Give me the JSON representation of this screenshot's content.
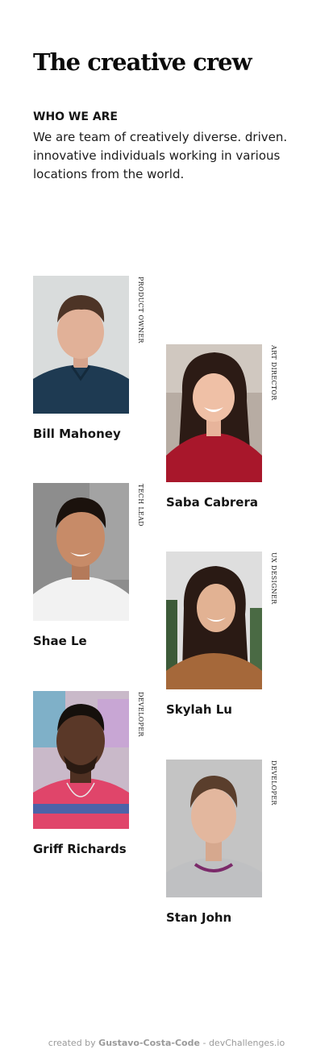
{
  "header": {
    "title": "The creative crew",
    "subtitle": "WHO WE ARE",
    "intro": "We are team of creatively diverse. driven. innovative individuals working in various locations from the world."
  },
  "team": [
    {
      "name": "Bill Mahoney",
      "role": "PRODUCT OWNER"
    },
    {
      "name": "Saba Cabrera",
      "role": "ART DIRECTOR"
    },
    {
      "name": "Shae Le",
      "role": "TECH LEAD"
    },
    {
      "name": "Skylah Lu",
      "role": "UX DESIGNER"
    },
    {
      "name": "Griff Richards",
      "role": "DEVELOPER"
    },
    {
      "name": "Stan John",
      "role": "DEVELOPER"
    }
  ],
  "footer": {
    "prefix": "created by",
    "author": "Gustavo-Costa-Code",
    "separator": "-",
    "site": "devChallenges.io"
  }
}
